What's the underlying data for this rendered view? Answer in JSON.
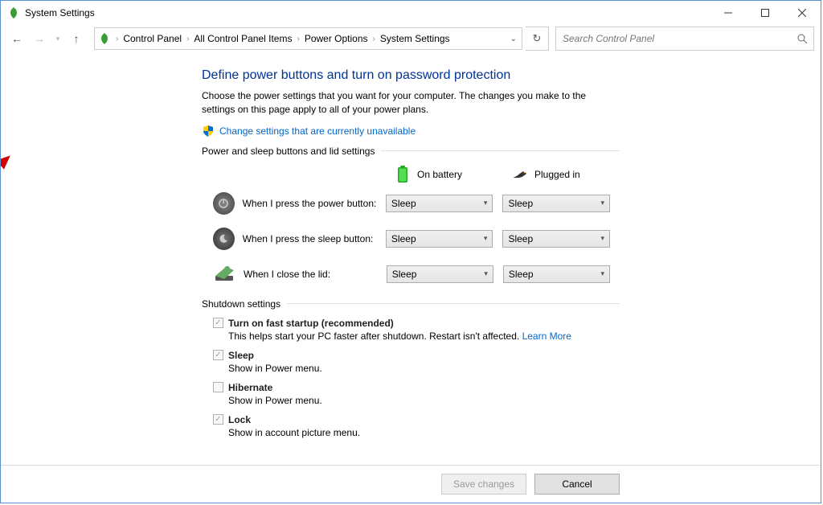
{
  "titlebar": {
    "title": "System Settings"
  },
  "breadcrumbs": {
    "items": [
      "Control Panel",
      "All Control Panel Items",
      "Power Options",
      "System Settings"
    ]
  },
  "search": {
    "placeholder": "Search Control Panel"
  },
  "page": {
    "heading": "Define power buttons and turn on password protection",
    "subtitle": "Choose the power settings that you want for your computer. The changes you make to the settings on this page apply to all of your power plans.",
    "change_link": "Change settings that are currently unavailable"
  },
  "columns": {
    "battery": "On battery",
    "plugged": "Plugged in"
  },
  "group1": {
    "title": "Power and sleep buttons and lid settings"
  },
  "rows": {
    "power": {
      "label": "When I press the power button:",
      "battery": "Sleep",
      "plugged": "Sleep"
    },
    "sleep": {
      "label": "When I press the sleep button:",
      "battery": "Sleep",
      "plugged": "Sleep"
    },
    "lid": {
      "label": "When I close the lid:",
      "battery": "Sleep",
      "plugged": "Sleep"
    }
  },
  "group2": {
    "title": "Shutdown settings"
  },
  "shutdown": {
    "fast": {
      "label": "Turn on fast startup (recommended)",
      "desc": "This helps start your PC faster after shutdown. Restart isn't affected. ",
      "learn": "Learn More"
    },
    "sleep": {
      "label": "Sleep",
      "desc": "Show in Power menu."
    },
    "hibernate": {
      "label": "Hibernate",
      "desc": "Show in Power menu."
    },
    "lock": {
      "label": "Lock",
      "desc": "Show in account picture menu."
    }
  },
  "buttons": {
    "save": "Save changes",
    "cancel": "Cancel"
  }
}
